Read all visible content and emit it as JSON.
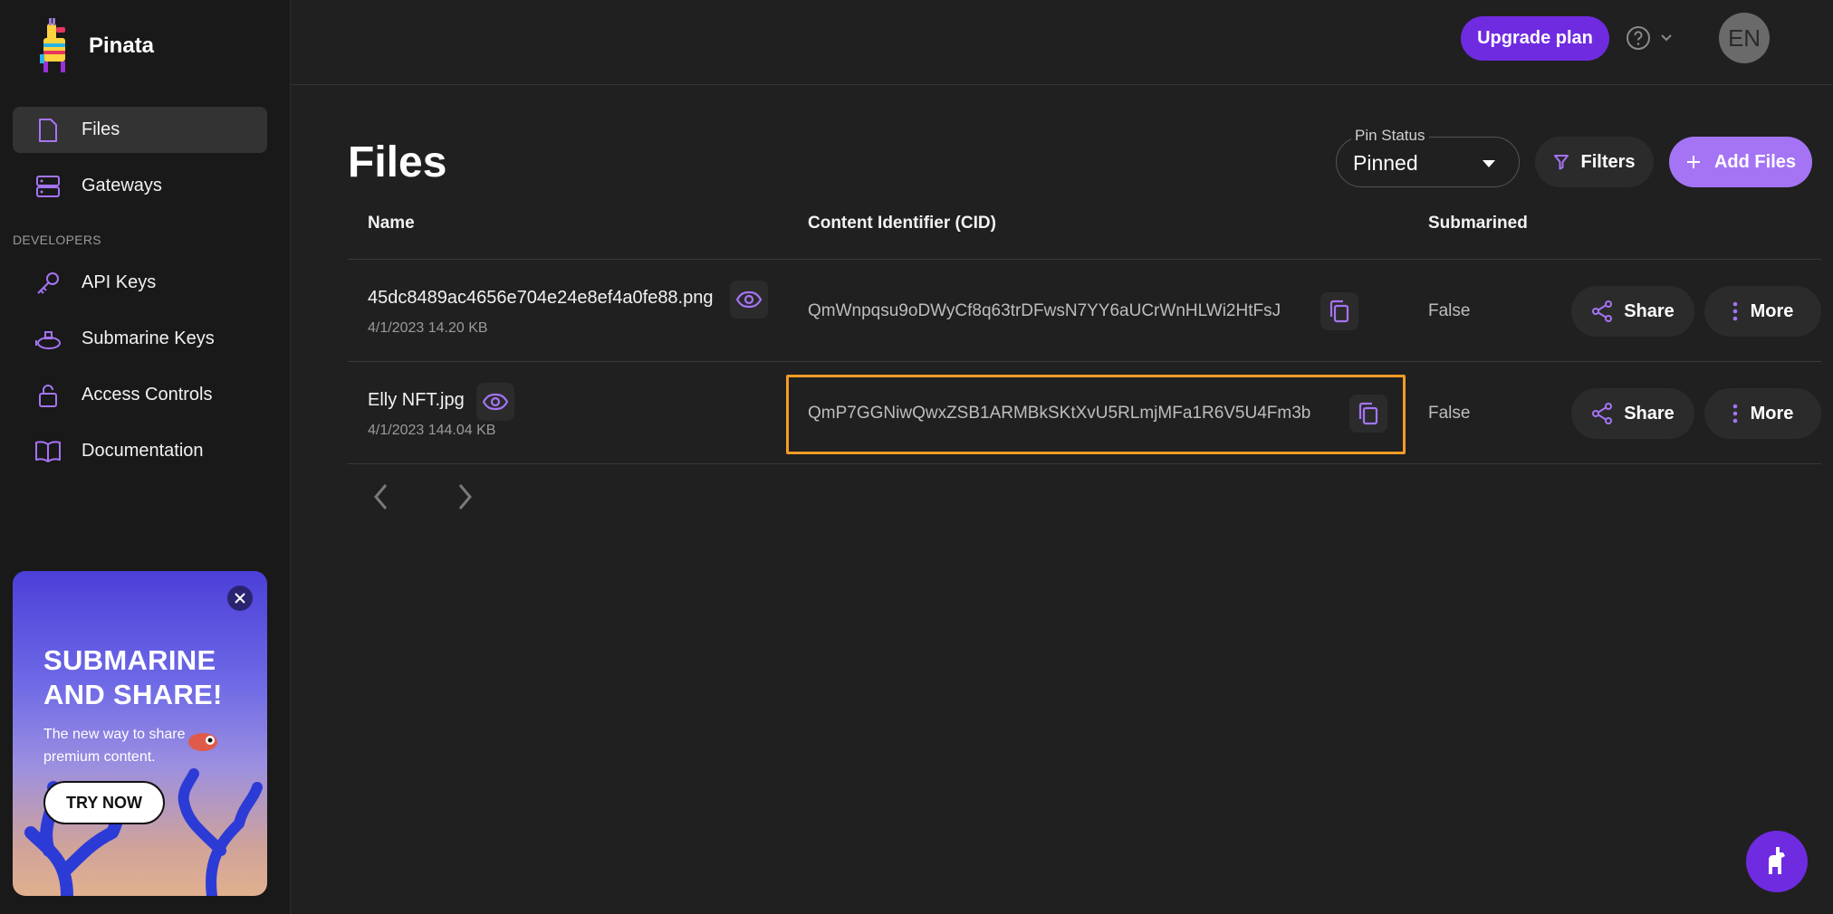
{
  "app": {
    "name": "Pinata"
  },
  "sidebar": {
    "items": [
      {
        "label": "Files",
        "icon": "file-icon",
        "active": true
      },
      {
        "label": "Gateways",
        "icon": "server-icon",
        "active": false
      }
    ],
    "section_label": "DEVELOPERS",
    "dev_items": [
      {
        "label": "API Keys",
        "icon": "key-icon"
      },
      {
        "label": "Submarine Keys",
        "icon": "submarine-icon"
      },
      {
        "label": "Access Controls",
        "icon": "lock-icon"
      },
      {
        "label": "Documentation",
        "icon": "book-icon"
      }
    ],
    "promo": {
      "title_line1": "SUBMARINE",
      "title_line2": "AND SHARE!",
      "text": "The new way to share premium content.",
      "button": "TRY NOW"
    }
  },
  "header": {
    "upgrade_label": "Upgrade plan",
    "avatar_initials": "EN"
  },
  "main": {
    "title": "Files",
    "pin_status": {
      "label": "Pin Status",
      "value": "Pinned"
    },
    "filters_label": "Filters",
    "add_files_label": "Add Files",
    "columns": [
      "Name",
      "Content Identifier (CID)",
      "Submarined"
    ],
    "rows": [
      {
        "name": "45dc8489ac4656e704e24e8ef4a0fe88.png",
        "meta": "4/1/2023 14.20 KB",
        "cid": "QmWnpqsu9oDWyCf8q63trDFwsN7YY6aUCrWnHLWi2HtFsJ",
        "submarined": "False",
        "share": "Share",
        "more": "More"
      },
      {
        "name": "Elly NFT.jpg",
        "meta": "4/1/2023 144.04 KB",
        "cid": "QmP7GGNiwQwxZSB1ARMBkSKtXvU5RLmjMFa1R6V5U4Fm3b",
        "submarined": "False",
        "share": "Share",
        "more": "More",
        "highlighted": true
      }
    ]
  },
  "colors": {
    "accent": "#6f2be0",
    "accent_light": "#a574f5",
    "highlight": "#f59b27"
  }
}
